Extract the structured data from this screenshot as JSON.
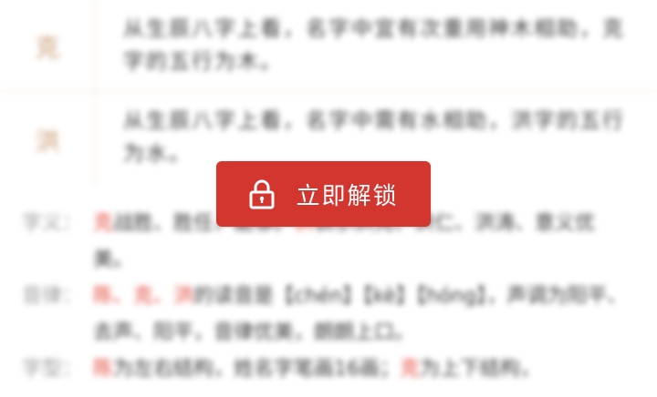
{
  "table": {
    "rows": [
      {
        "char": "克",
        "desc": "从生辰八字上看，名字中宜有次重用神木相助，克字的五行为木。"
      },
      {
        "char": "洪",
        "desc": "从生辰八字上看，名字中需有水相助，洪字的五行为水。"
      }
    ]
  },
  "details": {
    "meaning": {
      "label": "字义：",
      "hl1": "克",
      "text1": "战胜、胜任、能够。",
      "hl2": "洪",
      "text2": "表示洪亮、洪仁、洪涛、意义优美。"
    },
    "sound": {
      "label": "音律：",
      "hl": "陈、克、洪",
      "text": "的读音是【chén】【kè】【hóng】，声调为阳平、去声、阳平，音律优美，朗朗上口。"
    },
    "shape": {
      "label": "字型：",
      "hl1": "陈",
      "text1": "为左右结构，姓名字笔画16画；",
      "hl2": "克",
      "text2": "为上下结构，"
    }
  },
  "unlock_button": {
    "label": "立即解锁",
    "icon": "lock-icon"
  }
}
